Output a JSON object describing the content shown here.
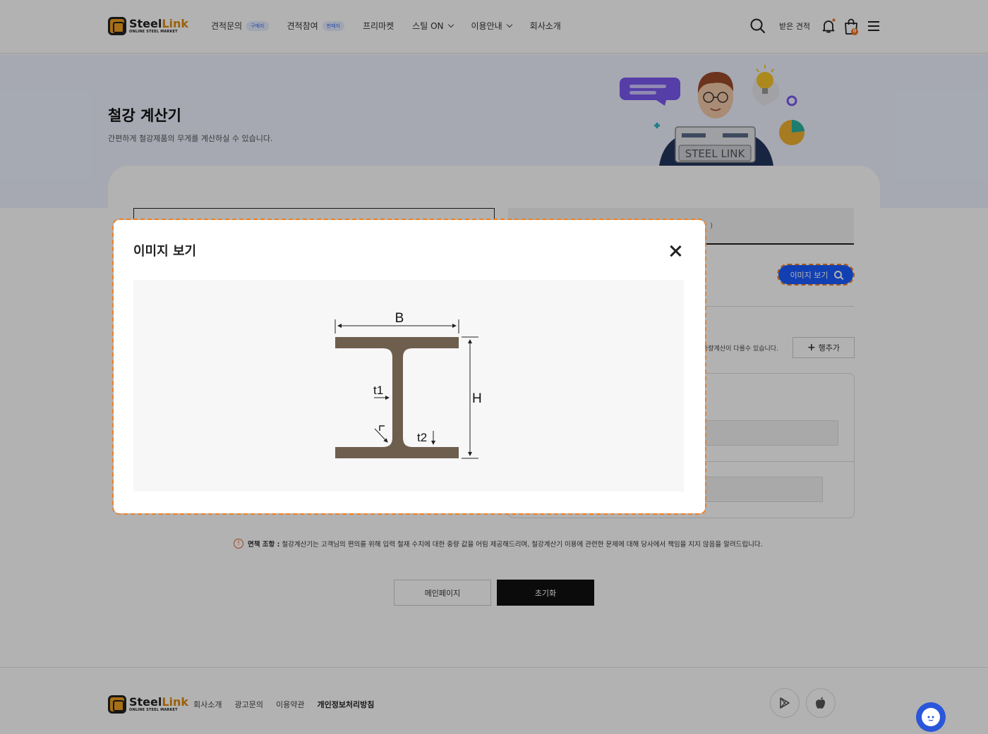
{
  "header": {
    "logo_name_1": "Steel",
    "logo_name_2": "Link",
    "logo_sub": "ONLINE STEEL MARKET",
    "nav": [
      {
        "label": "견적문의",
        "badge": "구매자"
      },
      {
        "label": "견적참여",
        "badge": "판매자"
      },
      {
        "label": "프리마켓"
      },
      {
        "label": "스틸 ON"
      },
      {
        "label": "이용안내"
      },
      {
        "label": "회사소개"
      }
    ],
    "received_label": "받은 견적",
    "cart_count": "0"
  },
  "hero": {
    "title": "철강 계산기",
    "description": "간편하게 철강제품의 무게를 계산하실 수 있습니다.",
    "illustration_text": "STEEL LINK"
  },
  "calculator": {
    "view_image_label": "이미지 보기",
    "tab_hint": ")",
    "note_text": "중량계산이 다를수 있습니다.",
    "add_row_label": "행추가"
  },
  "disclaimer": {
    "icon": "!",
    "title": "면책 조항 :",
    "text": "철강계산기는 고객님의 편의를 위해 입력 철재 수치에 대한 중량 값을 어림 제공해드리며, 철강계산기 이용에 관련한 문제에 대해 당사에서 책임을 지지 않음을 알려드립니다."
  },
  "actions": {
    "main_page_label": "메인페이지",
    "reset_label": "초기화"
  },
  "footer": {
    "links": [
      "회사소개",
      "광고문의",
      "이용약관",
      "개인정보처리방침"
    ]
  },
  "modal": {
    "title": "이미지 보기",
    "diagram_labels": {
      "B": "B",
      "H": "H",
      "t1": "t1",
      "t2": "t2"
    }
  },
  "colors": {
    "accent_blue": "#1a5cff",
    "steel_brown": "#6e5e4e",
    "highlight_orange": "#f08020",
    "logo_orange": "#e08a10"
  }
}
